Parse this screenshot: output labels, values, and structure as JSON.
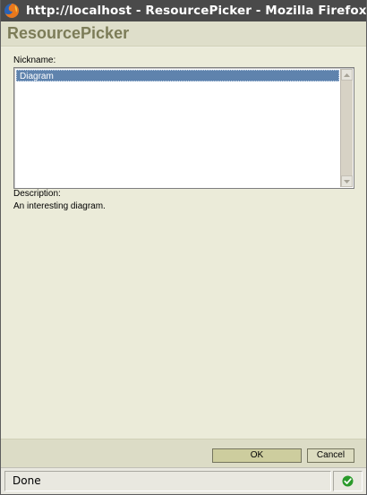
{
  "window": {
    "title": "http://localhost - ResourcePicker - Mozilla Firefox"
  },
  "header": {
    "title": "ResourcePicker"
  },
  "form": {
    "nickname_label": "Nickname:",
    "nickname_options": [
      {
        "label": "Diagram",
        "selected": true
      }
    ],
    "description_label": "Description:",
    "description_value": "An interesting diagram."
  },
  "buttons": {
    "ok": "OK",
    "cancel": "Cancel"
  },
  "statusbar": {
    "status_text": "Done",
    "security_icon": "check-icon"
  },
  "colors": {
    "selection": "#5f83ad",
    "header_title": "#7c7c58",
    "ok_button": "#cdcd9e",
    "check_icon": "#2a9a2a"
  }
}
